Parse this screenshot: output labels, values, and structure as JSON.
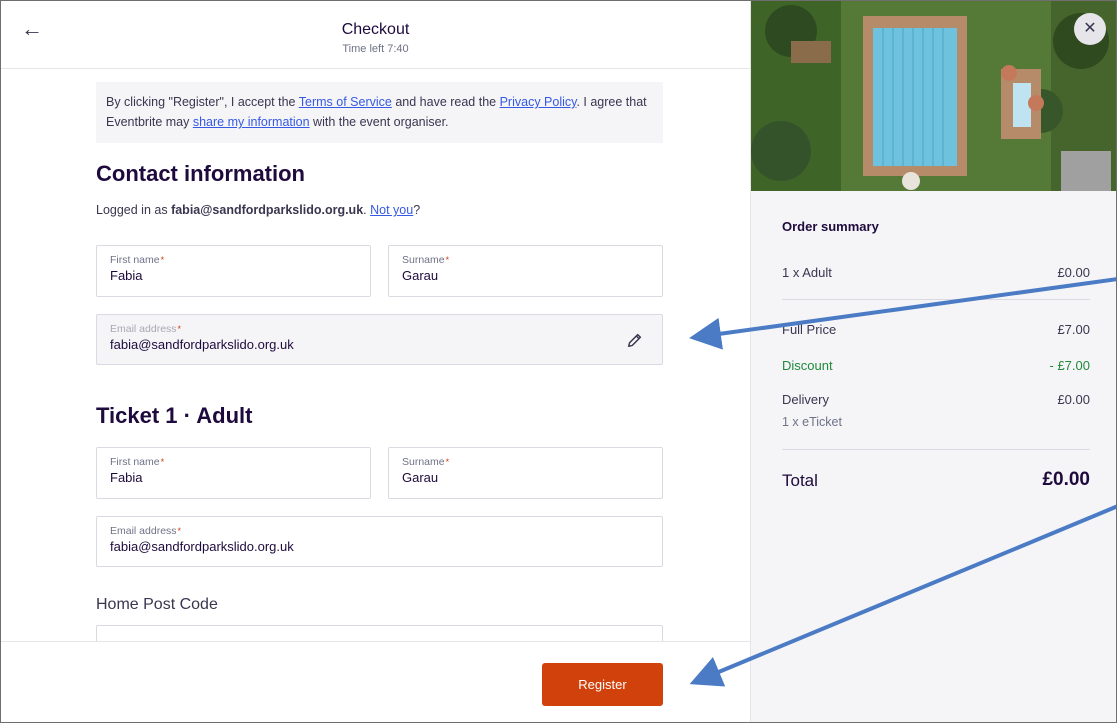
{
  "header": {
    "title": "Checkout",
    "time_left": "Time left 7:40"
  },
  "notice": {
    "part1": "By clicking \"Register\", I accept the ",
    "terms_link": "Terms of Service",
    "part2": " and have read the ",
    "privacy_link": "Privacy Policy",
    "part3": ". I agree that Eventbrite may ",
    "share_link": "share my information",
    "part4": " with the event organiser."
  },
  "contact": {
    "heading": "Contact information",
    "logged_prefix": "Logged in as ",
    "logged_email": "fabia@sandfordparkslido.org.uk",
    "logged_sep": ". ",
    "not_you": "Not you",
    "logged_suffix": "?",
    "first_name_label": "First name",
    "first_name_value": "Fabia",
    "surname_label": "Surname",
    "surname_value": "Garau",
    "email_label": "Email address",
    "email_value": "fabia@sandfordparkslido.org.uk",
    "required_mark": "*"
  },
  "ticket": {
    "heading": "Ticket 1 · Adult",
    "first_name_label": "First name",
    "first_name_value": "Fabia",
    "surname_label": "Surname",
    "surname_value": "Garau",
    "email_label": "Email address",
    "email_value": "fabia@sandfordparkslido.org.uk",
    "post_code_heading": "Home Post Code"
  },
  "footer": {
    "register_label": "Register"
  },
  "order_summary": {
    "title": "Order summary",
    "line_item": "1 x Adult",
    "line_item_price": "£0.00",
    "full_price_label": "Full Price",
    "full_price_value": "£7.00",
    "discount_label": "Discount",
    "discount_value": "- £7.00",
    "delivery_label": "Delivery",
    "delivery_value": "£0.00",
    "delivery_note": "1 x eTicket",
    "total_label": "Total",
    "total_value": "£0.00"
  },
  "icons": {
    "back": "arrow-left-icon",
    "close": "close-icon",
    "edit": "pencil-icon"
  },
  "colors": {
    "accent": "#d1410c",
    "link": "#3659e3",
    "discount": "#1f8a3a",
    "annotation_arrow": "#4a7bc4"
  }
}
